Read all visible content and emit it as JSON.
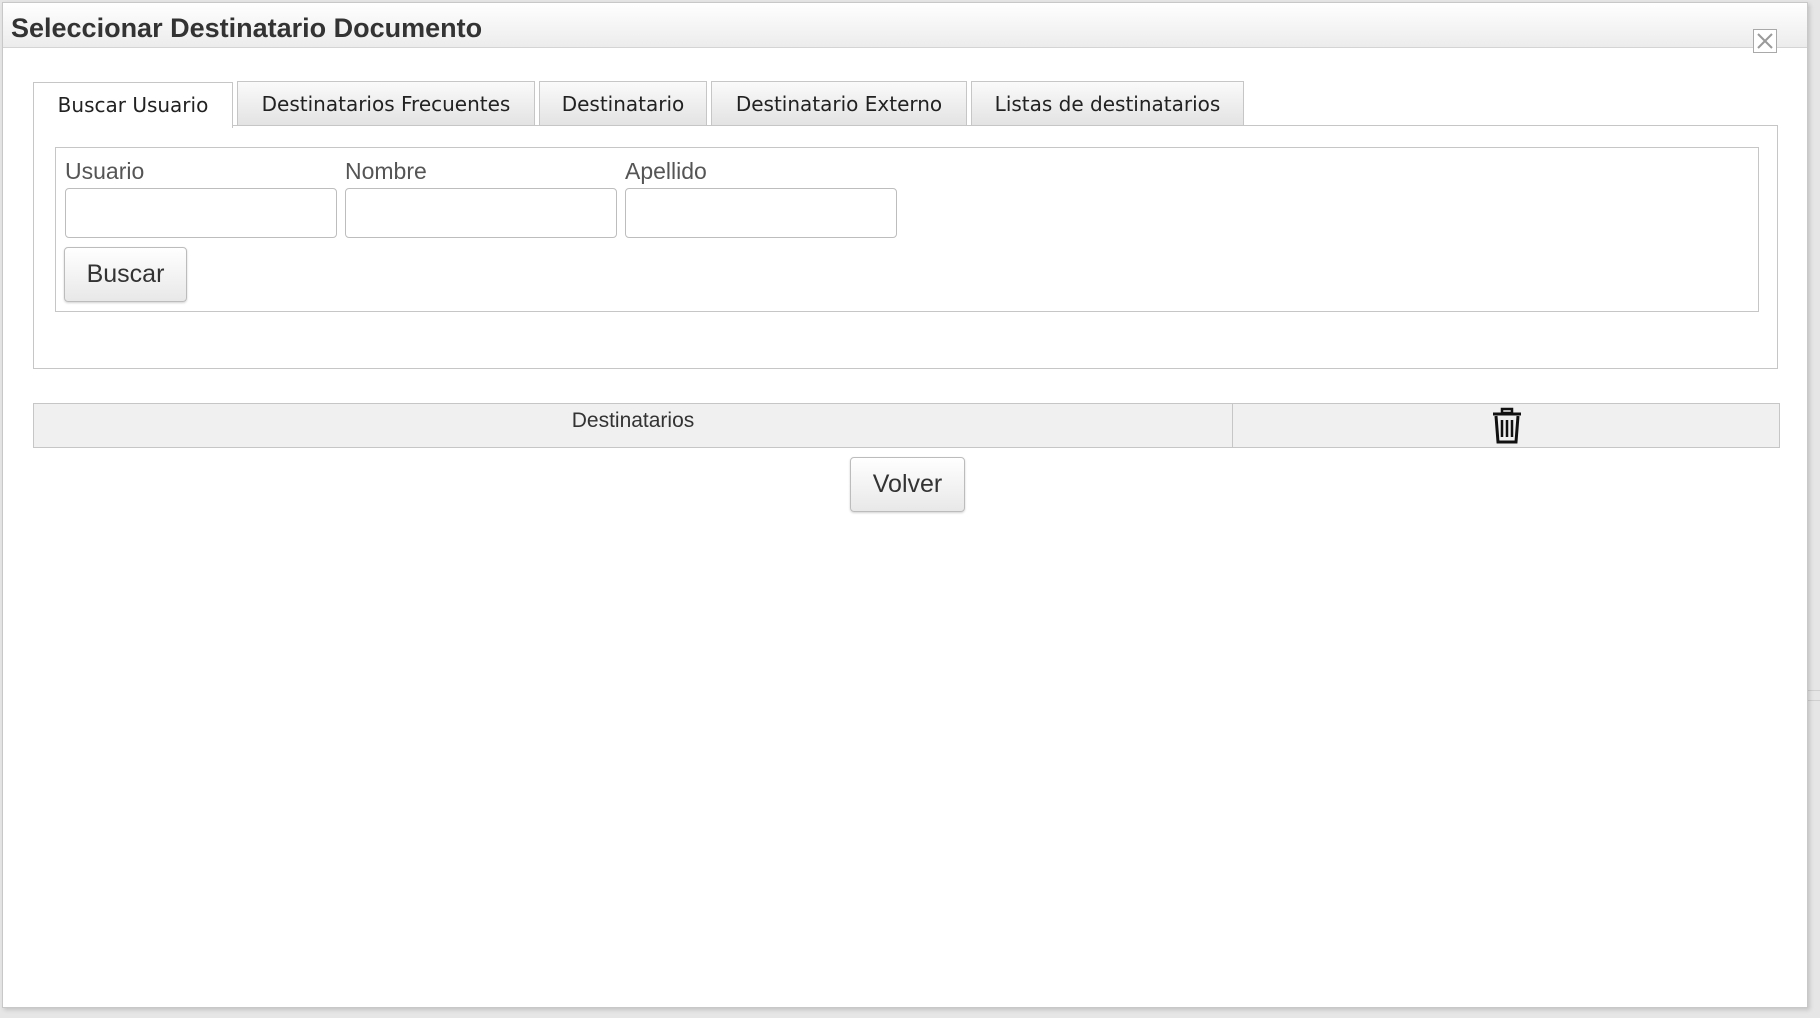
{
  "dialog": {
    "title": "Seleccionar Destinatario Documento",
    "close_icon": "close-icon"
  },
  "tabs": [
    {
      "label": "Buscar Usuario",
      "active": true
    },
    {
      "label": "Destinatarios Frecuentes",
      "active": false
    },
    {
      "label": "Destinatario",
      "active": false
    },
    {
      "label": "Destinatario Externo",
      "active": false
    },
    {
      "label": "Listas de destinatarios",
      "active": false
    }
  ],
  "search": {
    "fields": [
      {
        "label": "Usuario",
        "value": ""
      },
      {
        "label": "Nombre",
        "value": ""
      },
      {
        "label": "Apellido",
        "value": ""
      }
    ],
    "button_label": "Buscar"
  },
  "recipients_table": {
    "header": "Destinatarios",
    "delete_icon": "trash-icon"
  },
  "footer": {
    "back_label": "Volver"
  }
}
